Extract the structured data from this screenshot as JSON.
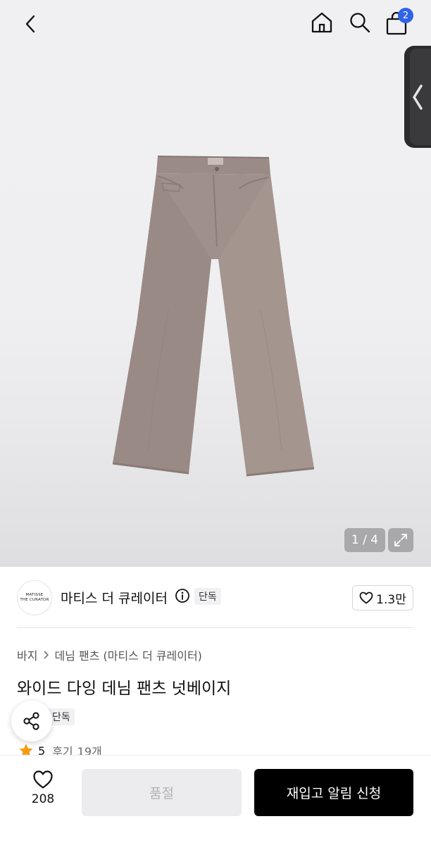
{
  "header": {
    "cart_badge": "2"
  },
  "gallery": {
    "pager_text": "1 / 4",
    "current_image": 1,
    "total_images": 4
  },
  "brand": {
    "logo_line1": "MATISSE",
    "logo_line2": "THE CURATOR",
    "name": "마티스 더 큐레이터",
    "exclusive_label": "단독",
    "like_count": "1.3만"
  },
  "breadcrumb": {
    "category": "바지",
    "subcategory": "데님 팬츠 (마티스 더 큐레이터)"
  },
  "product": {
    "title": "와이드 다잉 데님 팬츠 넛베이지",
    "tag": "단독",
    "rating": "5",
    "review_label": "후기",
    "review_count": "19개"
  },
  "bottom_bar": {
    "wish_count": "208",
    "soldout_label": "품절",
    "restock_label": "재입고 알림 신청"
  },
  "colors": {
    "accent_badge": "#2f63e8",
    "star": "#f39c12",
    "primary_button": "#000000",
    "disabled_button": "#ececee"
  }
}
